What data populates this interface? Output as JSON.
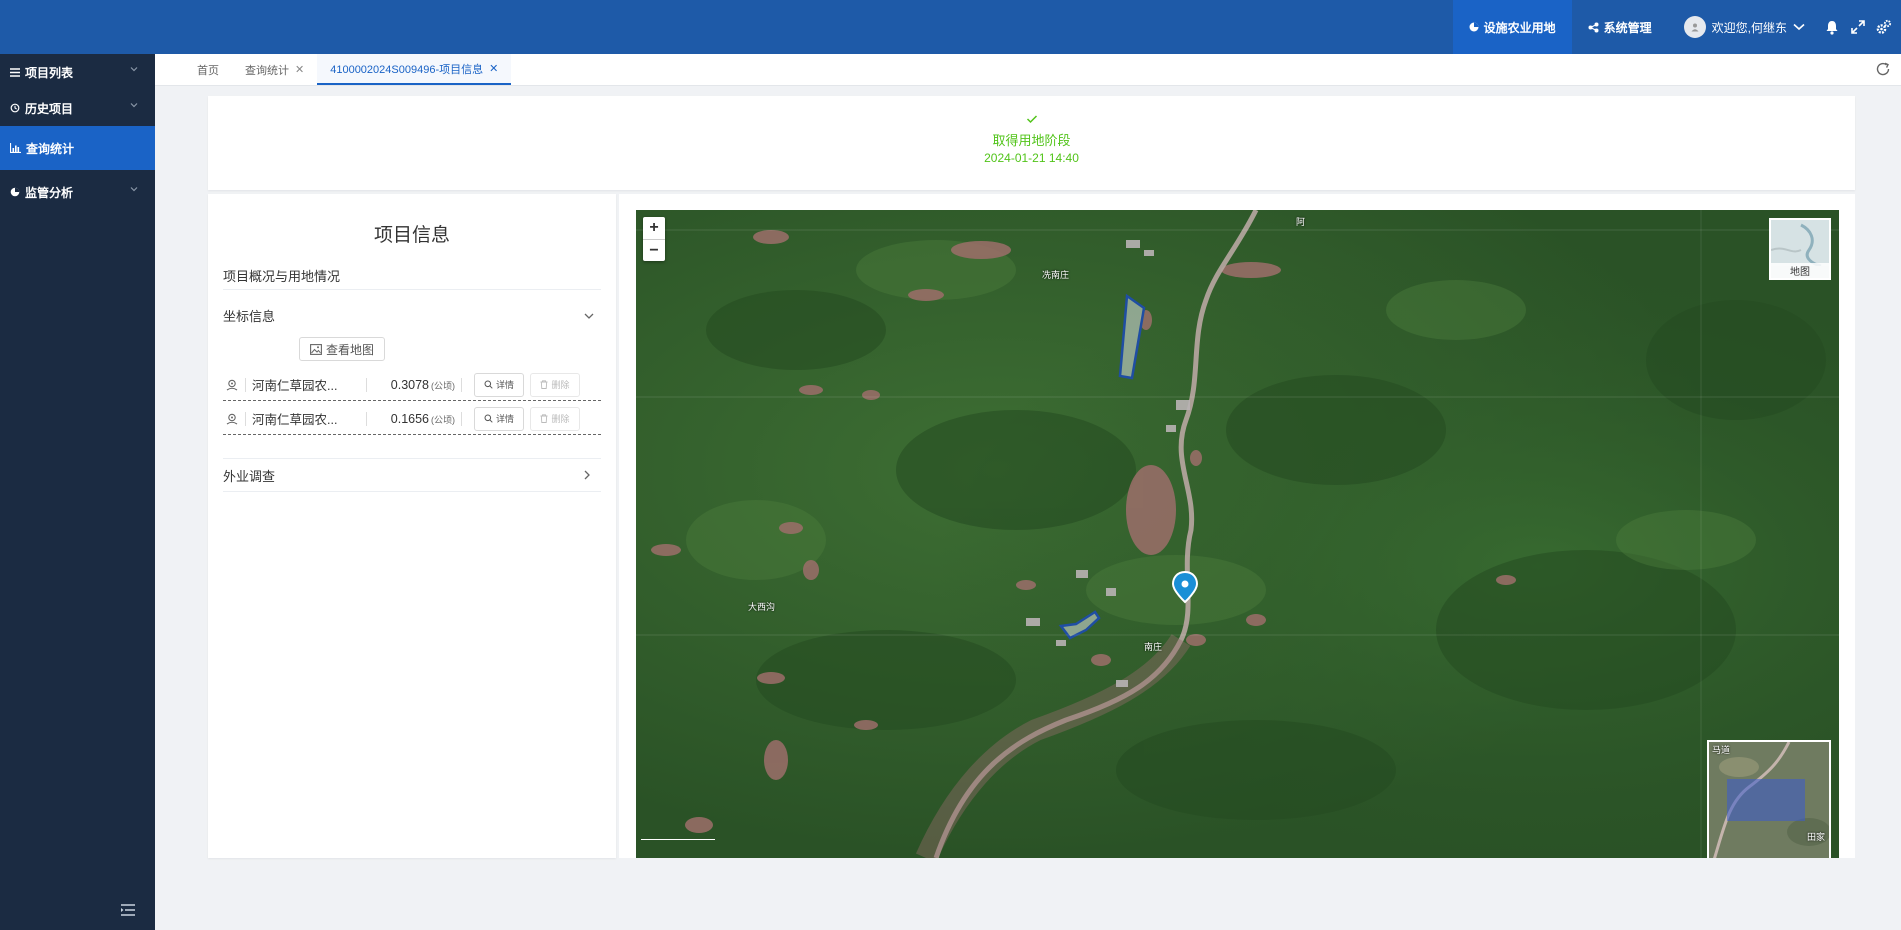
{
  "header": {
    "nav": [
      {
        "label": "设施农业用地",
        "icon": "pie-chart-icon",
        "active": true
      },
      {
        "label": "系统管理",
        "icon": "share-icon",
        "active": false
      }
    ],
    "user_greeting": "欢迎您,何继东"
  },
  "sidebar": {
    "items": [
      {
        "label": "项目列表",
        "icon": "menu-icon",
        "has_children": true
      },
      {
        "label": "历史项目",
        "icon": "history-icon",
        "has_children": true
      },
      {
        "label": "查询统计",
        "icon": "bar-chart-icon",
        "has_children": false,
        "active": true
      },
      {
        "label": "监管分析",
        "icon": "pie-chart-icon",
        "has_children": true
      }
    ]
  },
  "tabs": [
    {
      "label": "首页",
      "closable": false,
      "active": false
    },
    {
      "label": "查询统计",
      "closable": true,
      "active": false
    },
    {
      "label": "4100002024S009496-项目信息",
      "closable": true,
      "active": true
    }
  ],
  "stage": {
    "title": "取得用地阶段",
    "time": "2024-01-21 14:40"
  },
  "info_panel": {
    "title": "项目信息",
    "overview_label": "项目概况与用地情况",
    "coord_label": "坐标信息",
    "view_map_label": "查看地图",
    "field_survey_label": "外业调查",
    "unit": "(公顷)",
    "detail_label": "详情",
    "delete_label": "删除",
    "coordinates": [
      {
        "name": "河南仁草园农...",
        "area": "0.3078"
      },
      {
        "name": "河南仁草园农...",
        "area": "0.1656"
      }
    ]
  },
  "map": {
    "zoom_in": "+",
    "zoom_out": "−",
    "layer_label": "地图",
    "labels": [
      "冼南庄",
      "大西沟",
      "南庄",
      "阿"
    ],
    "overview_labels": [
      "马道",
      "田家"
    ]
  }
}
